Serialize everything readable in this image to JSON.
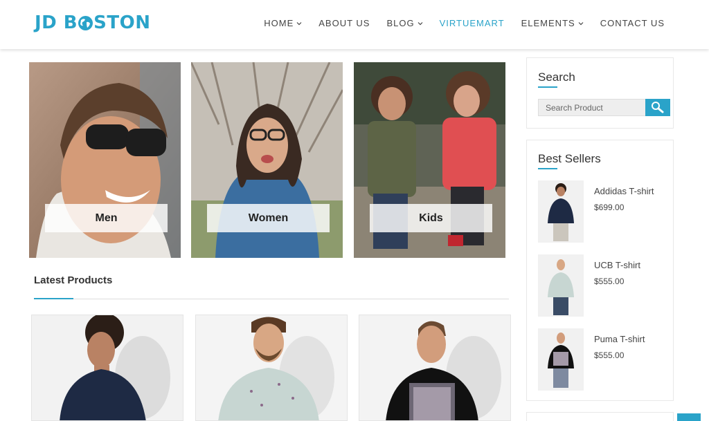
{
  "brand": {
    "logo_pre": "JD B",
    "logo_post": "STON",
    "accent": "#2aa3c9"
  },
  "nav": [
    {
      "label": "HOME",
      "dropdown": true
    },
    {
      "label": "ABOUT US",
      "dropdown": false
    },
    {
      "label": "BLOG",
      "dropdown": true
    },
    {
      "label": "VIRTUEMART",
      "dropdown": false,
      "active": true
    },
    {
      "label": "ELEMENTS",
      "dropdown": true
    },
    {
      "label": "CONTACT US",
      "dropdown": false
    }
  ],
  "categories": [
    {
      "label": "Men"
    },
    {
      "label": "Women"
    },
    {
      "label": "Kids"
    }
  ],
  "latest": {
    "title": "Latest Products"
  },
  "search": {
    "title": "Search",
    "placeholder": "Search Product",
    "icon": "search-icon"
  },
  "best_sellers": {
    "title": "Best Sellers",
    "items": [
      {
        "name": "Addidas T-shirt",
        "price": "$699.00"
      },
      {
        "name": "UCB T-shirt",
        "price": "$555.00"
      },
      {
        "name": "Puma T-shirt",
        "price": "$555.00"
      }
    ]
  }
}
